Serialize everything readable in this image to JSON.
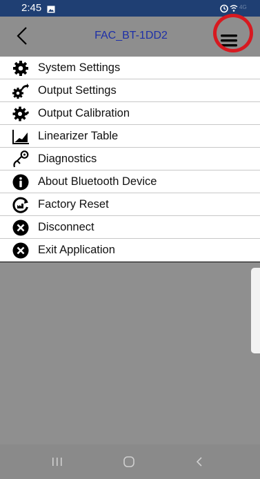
{
  "status_bar": {
    "time": "2:45",
    "icons": [
      "gallery-icon",
      "alarm-icon",
      "wifi-icon",
      "lte-icon",
      "battery-icon"
    ],
    "lte_text": "4G"
  },
  "header": {
    "title": "FAC_BT-1DD2",
    "back_icon": "chevron-left-icon",
    "menu_icon": "hamburger-menu-icon"
  },
  "menu": {
    "items": [
      {
        "label": "System Settings",
        "icon": "gear-icon"
      },
      {
        "label": "Output Settings",
        "icon": "output-settings-icon"
      },
      {
        "label": "Output Calibration",
        "icon": "calibration-gear-icon"
      },
      {
        "label": "Linearizer Table",
        "icon": "chart-icon"
      },
      {
        "label": "Diagnostics",
        "icon": "stethoscope-icon"
      },
      {
        "label": "About Bluetooth Device",
        "icon": "info-icon"
      },
      {
        "label": "Factory Reset",
        "icon": "factory-reset-icon"
      },
      {
        "label": "Disconnect",
        "icon": "close-circle-icon"
      },
      {
        "label": "Exit Application",
        "icon": "close-circle-icon"
      }
    ]
  },
  "nav_bar": {
    "icons": [
      "recents-icon",
      "home-icon",
      "back-icon"
    ]
  },
  "colors": {
    "status_bar": "#1f3f73",
    "app_bar": "#8e8e8e",
    "title": "#1d2fa8",
    "highlight": "#d71920",
    "menu_bg": "#ffffff"
  }
}
